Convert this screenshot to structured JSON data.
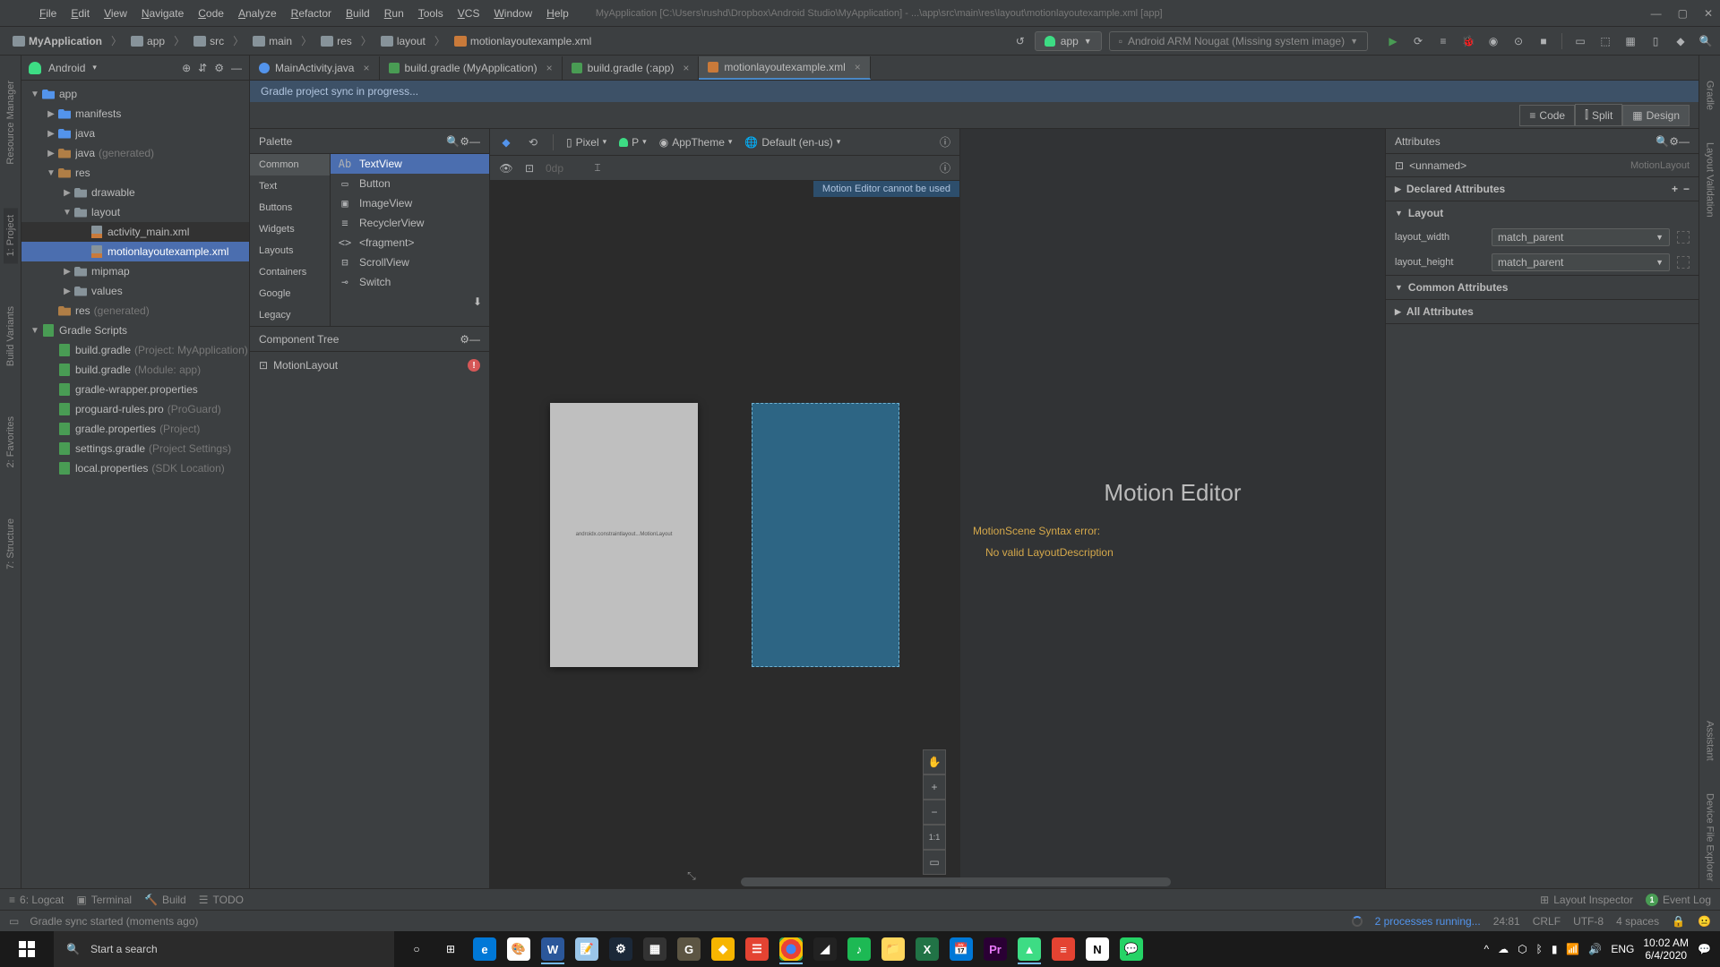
{
  "menu": {
    "items": [
      "File",
      "Edit",
      "View",
      "Navigate",
      "Code",
      "Analyze",
      "Refactor",
      "Build",
      "Run",
      "Tools",
      "VCS",
      "Window",
      "Help"
    ],
    "title": "MyApplication [C:\\Users\\rushd\\Dropbox\\Android Studio\\MyApplication] - ...\\app\\src\\main\\res\\layout\\motionlayoutexample.xml [app]"
  },
  "breadcrumb": [
    "MyApplication",
    "app",
    "src",
    "main",
    "res",
    "layout",
    "motionlayoutexample.xml"
  ],
  "run": {
    "config": "app",
    "device": "Android ARM Nougat (Missing system image)"
  },
  "project_dropdown": "Android",
  "tree": [
    {
      "d": 0,
      "a": "▼",
      "i": "folder-blue",
      "l": "app"
    },
    {
      "d": 1,
      "a": "▶",
      "i": "folder-blue",
      "l": "manifests"
    },
    {
      "d": 1,
      "a": "▶",
      "i": "folder-blue",
      "l": "java"
    },
    {
      "d": 1,
      "a": "▶",
      "i": "folder-orange",
      "l": "java",
      "sub": "(generated)"
    },
    {
      "d": 1,
      "a": "▼",
      "i": "folder-orange",
      "l": "res"
    },
    {
      "d": 2,
      "a": "▶",
      "i": "folder",
      "l": "drawable"
    },
    {
      "d": 2,
      "a": "▼",
      "i": "folder",
      "l": "layout"
    },
    {
      "d": 3,
      "a": "",
      "i": "xml",
      "l": "activity_main.xml",
      "hl": true
    },
    {
      "d": 3,
      "a": "",
      "i": "xml",
      "l": "motionlayoutexample.xml",
      "sel": true
    },
    {
      "d": 2,
      "a": "▶",
      "i": "folder",
      "l": "mipmap"
    },
    {
      "d": 2,
      "a": "▶",
      "i": "folder",
      "l": "values"
    },
    {
      "d": 1,
      "a": "",
      "i": "folder-orange",
      "l": "res",
      "sub": "(generated)"
    },
    {
      "d": 0,
      "a": "▼",
      "i": "gradle",
      "l": "Gradle Scripts"
    },
    {
      "d": 1,
      "a": "",
      "i": "gradle",
      "l": "build.gradle",
      "sub": "(Project: MyApplication)"
    },
    {
      "d": 1,
      "a": "",
      "i": "gradle",
      "l": "build.gradle",
      "sub": "(Module: app)"
    },
    {
      "d": 1,
      "a": "",
      "i": "gradle",
      "l": "gradle-wrapper.properties",
      "sub": ""
    },
    {
      "d": 1,
      "a": "",
      "i": "gradle",
      "l": "proguard-rules.pro",
      "sub": "(ProGuard)"
    },
    {
      "d": 1,
      "a": "",
      "i": "gradle",
      "l": "gradle.properties",
      "sub": "(Project)"
    },
    {
      "d": 1,
      "a": "",
      "i": "gradle",
      "l": "settings.gradle",
      "sub": "(Project Settings)"
    },
    {
      "d": 1,
      "a": "",
      "i": "gradle",
      "l": "local.properties",
      "sub": "(SDK Location)"
    }
  ],
  "tabs": [
    {
      "l": "MainActivity.java",
      "t": "java"
    },
    {
      "l": "build.gradle (MyApplication)",
      "t": "gradle"
    },
    {
      "l": "build.gradle (:app)",
      "t": "gradle"
    },
    {
      "l": "motionlayoutexample.xml",
      "t": "xml",
      "active": true
    }
  ],
  "sync_msg": "Gradle project sync in progress...",
  "view_modes": [
    "Code",
    "Split",
    "Design"
  ],
  "palette": {
    "title": "Palette",
    "cats": [
      "Common",
      "Text",
      "Buttons",
      "Widgets",
      "Layouts",
      "Containers",
      "Google",
      "Legacy"
    ],
    "items": [
      "TextView",
      "Button",
      "ImageView",
      "RecyclerView",
      "<fragment>",
      "ScrollView",
      "Switch"
    ]
  },
  "canvas_toolbar": {
    "device": "Pixel",
    "api": "P",
    "theme": "AppTheme",
    "locale": "Default (en-us)"
  },
  "canvas_zoom": "0dp",
  "canvas_info": "Motion Editor cannot be used",
  "device_hint": "androidx.constraintlayout...MotionLayout",
  "comp_tree": {
    "title": "Component Tree",
    "root": "MotionLayout"
  },
  "motion": {
    "title": "Motion Editor",
    "err1": "MotionScene Syntax error:",
    "err2": "No valid LayoutDescription"
  },
  "attr": {
    "title": "Attributes",
    "id": "<unnamed>",
    "type": "MotionLayout",
    "sections": {
      "declared": "Declared Attributes",
      "layout": "Layout",
      "common": "Common Attributes",
      "all": "All Attributes"
    },
    "layout_width": {
      "label": "layout_width",
      "value": "match_parent"
    },
    "layout_height": {
      "label": "layout_height",
      "value": "match_parent"
    }
  },
  "bottom": {
    "logcat": "6: Logcat",
    "terminal": "Terminal",
    "build": "Build",
    "todo": "TODO",
    "inspector": "Layout Inspector",
    "eventlog": "Event Log"
  },
  "status": {
    "msg": "Gradle sync started (moments ago)",
    "proc": "2 processes running...",
    "pos": "24:81",
    "eol": "CRLF",
    "enc": "UTF-8",
    "indent": "4 spaces"
  },
  "left_gutter": [
    "Resource Manager",
    "1: Project",
    "Build Variants",
    "2: Favorites",
    "7: Structure"
  ],
  "right_gutter": [
    "Gradle",
    "Layout Validation",
    "Assistant",
    "Device File Explorer"
  ],
  "taskbar": {
    "search": "Start a search",
    "lang": "ENG",
    "time": "10:02 AM",
    "date": "6/4/2020"
  }
}
